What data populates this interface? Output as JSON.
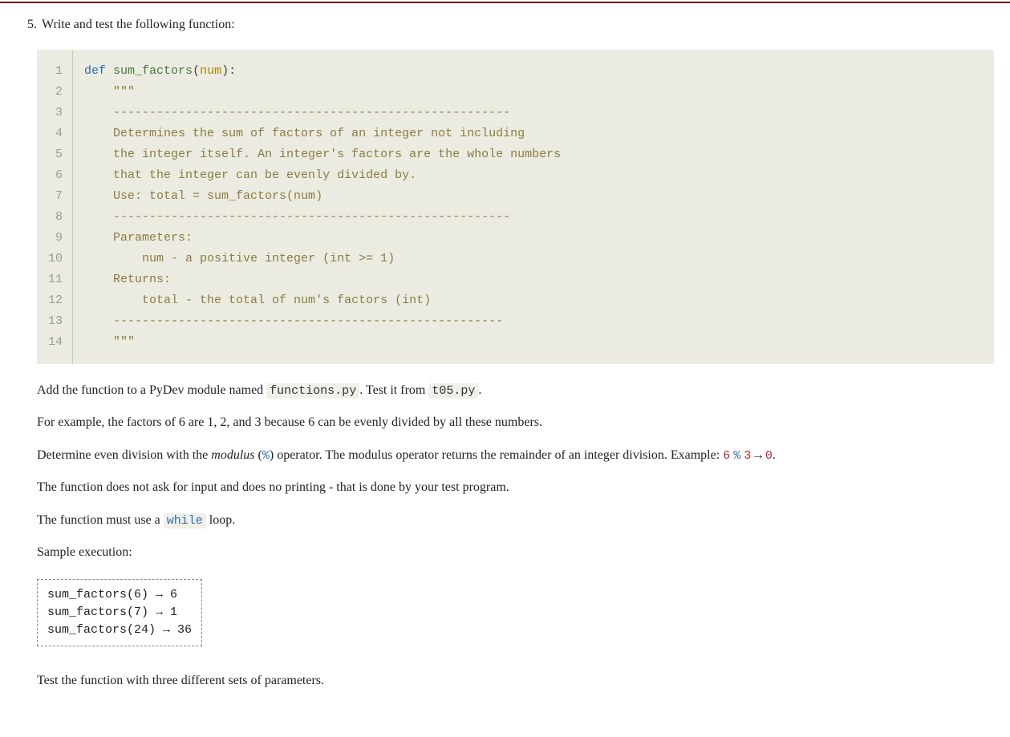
{
  "question": {
    "number": "5.",
    "prompt": "Write and test the following function:"
  },
  "code": {
    "lines": [
      {
        "n": "1",
        "html": "<span class='kw'>def</span> <span class='fn'>sum_factors</span><span class='paren'>(</span><span class='param'>num</span><span class='paren'>):</span>"
      },
      {
        "n": "2",
        "html": "    <span class='str'>\"\"\"</span>"
      },
      {
        "n": "3",
        "html": "<span class='str'>    -------------------------------------------------------</span>"
      },
      {
        "n": "4",
        "html": "<span class='str'>    Determines the sum of factors of an integer not including</span>"
      },
      {
        "n": "5",
        "html": "<span class='str'>    the integer itself. An integer's factors are the whole numbers</span>"
      },
      {
        "n": "6",
        "html": "<span class='str'>    that the integer can be evenly divided by.</span>"
      },
      {
        "n": "7",
        "html": "<span class='str'>    Use: total = sum_factors(num)</span>"
      },
      {
        "n": "8",
        "html": "<span class='str'>    -------------------------------------------------------</span>"
      },
      {
        "n": "9",
        "html": "<span class='str'>    Parameters:</span>"
      },
      {
        "n": "10",
        "html": "<span class='str'>        num - a positive integer (int >= 1)</span>"
      },
      {
        "n": "11",
        "html": "<span class='str'>    Returns:</span>"
      },
      {
        "n": "12",
        "html": "<span class='str'>        total - the total of num's factors (int)</span>"
      },
      {
        "n": "13",
        "html": "<span class='str'>    ------------------------------------------------------</span>"
      },
      {
        "n": "14",
        "html": "<span class='str'>    \"\"\"</span>"
      }
    ]
  },
  "paragraphs": {
    "p1_a": "Add the function to a PyDev module named ",
    "p1_code1": "functions.py",
    "p1_b": ". Test it from ",
    "p1_code2": "t05.py",
    "p1_c": ".",
    "p2": "For example, the factors of 6 are 1, 2, and 3 because 6 can be evenly divided by all these numbers.",
    "p3_a": "Determine even division with the ",
    "p3_em": "modulus",
    "p3_b": " (",
    "p3_op": "%",
    "p3_c": ") operator. The modulus operator returns the remainder of an integer division. Example: ",
    "p3_ex_1": "6",
    "p3_ex_2": "%",
    "p3_ex_3": "3",
    "p3_ex_arrow": "→",
    "p3_ex_4": "0",
    "p3_d": ".",
    "p4": "The function does not ask for input and does no printing - that is done by your test program.",
    "p5_a": "The function must use a ",
    "p5_code": "while",
    "p5_b": " loop.",
    "p6": "Sample execution:"
  },
  "sample": {
    "lines": [
      "sum_factors(6) → 6",
      "sum_factors(7) → 1",
      "sum_factors(24) → 36"
    ]
  },
  "closing": "Test the function with three different sets of parameters."
}
